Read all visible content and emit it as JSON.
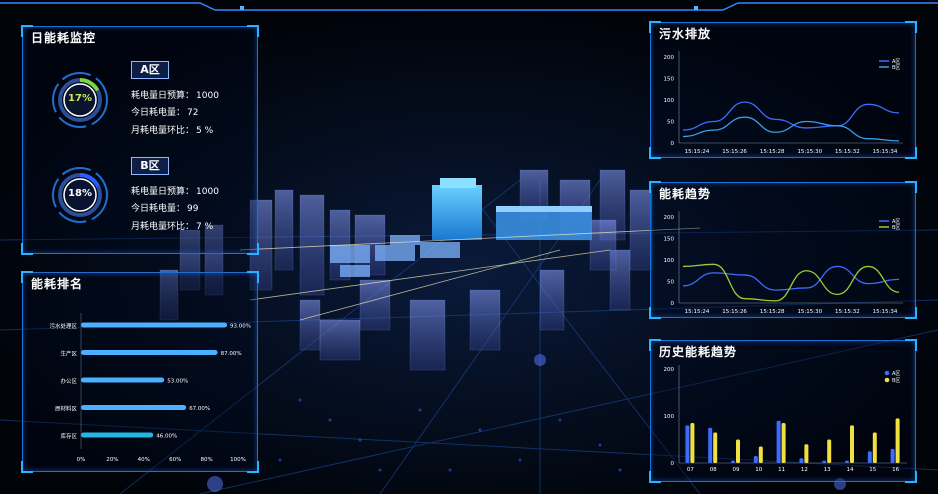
{
  "monitor": {
    "title": "日能耗监控",
    "zones": [
      {
        "name": "A区",
        "percent": "17%",
        "fraction": 0.17,
        "ring_color": "#7cd63d",
        "budget_label": "耗电量日预算：",
        "budget": "1000",
        "today_label": "今日耗电量：",
        "today": "72",
        "month_label": "月耗电量环比：",
        "month": "5 %"
      },
      {
        "name": "B区",
        "percent": "18%",
        "fraction": 0.18,
        "ring_color": "#2b5cff",
        "budget_label": "耗电量日预算：",
        "budget": "1000",
        "today_label": "今日耗电量：",
        "today": "99",
        "month_label": "月耗电量环比：",
        "month": "7 %"
      }
    ]
  },
  "ranking": {
    "title": "能耗排名",
    "chart_data": {
      "type": "bar",
      "orientation": "horizontal",
      "categories": [
        "污水处理区",
        "生产区",
        "办公区",
        "原材料区",
        "库存区"
      ],
      "values": [
        93,
        87,
        53,
        67,
        46
      ],
      "value_labels": [
        "93.00%",
        "87.00%",
        "53.00%",
        "67.00%",
        "46.00%"
      ],
      "xticks": [
        "0%",
        "20%",
        "40%",
        "60%",
        "80%",
        "100%"
      ],
      "xlim": [
        0,
        100
      ]
    }
  },
  "sewage": {
    "title": "污水排放",
    "chart_data": {
      "type": "line",
      "x": [
        "15:15:24",
        "15:15:26",
        "15:15:28",
        "15:15:30",
        "15:15:32",
        "15:15:34"
      ],
      "yticks": [
        "0",
        "50",
        "100",
        "150",
        "200"
      ],
      "ylim": [
        0,
        200
      ],
      "series": [
        {
          "name": "A区",
          "color": "#3d6bff",
          "values": [
            30,
            50,
            95,
            55,
            35,
            40,
            90,
            70
          ]
        },
        {
          "name": "B区",
          "color": "#3a9ee8",
          "values": [
            15,
            30,
            60,
            25,
            50,
            40,
            10,
            5
          ]
        }
      ],
      "samples": 8
    }
  },
  "trend": {
    "title": "能耗趋势",
    "chart_data": {
      "type": "line",
      "x": [
        "15:15:24",
        "15:15:26",
        "15:15:28",
        "15:15:30",
        "15:15:32",
        "15:15:34"
      ],
      "yticks": [
        "0",
        "50",
        "100",
        "150",
        "200"
      ],
      "ylim": [
        0,
        200
      ],
      "series": [
        {
          "name": "A区",
          "color": "#3d6bff",
          "values": [
            40,
            70,
            65,
            30,
            35,
            85,
            45,
            55
          ]
        },
        {
          "name": "B区",
          "color": "#9acd32",
          "values": [
            85,
            90,
            10,
            5,
            75,
            20,
            85,
            25
          ]
        }
      ],
      "samples": 8
    }
  },
  "history": {
    "title": "历史能耗趋势",
    "chart_data": {
      "type": "bar",
      "categories": [
        "07",
        "08",
        "09",
        "10",
        "11",
        "12",
        "13",
        "14",
        "15",
        "16"
      ],
      "yticks": [
        "0",
        "100",
        "200"
      ],
      "ylim": [
        0,
        200
      ],
      "series": [
        {
          "name": "A区",
          "color": "#3d6bff",
          "values": [
            80,
            75,
            5,
            15,
            90,
            10,
            5,
            5,
            25,
            30
          ]
        },
        {
          "name": "B区",
          "color": "#f0e040",
          "values": [
            85,
            65,
            50,
            35,
            85,
            40,
            50,
            80,
            65,
            95
          ]
        }
      ]
    }
  }
}
